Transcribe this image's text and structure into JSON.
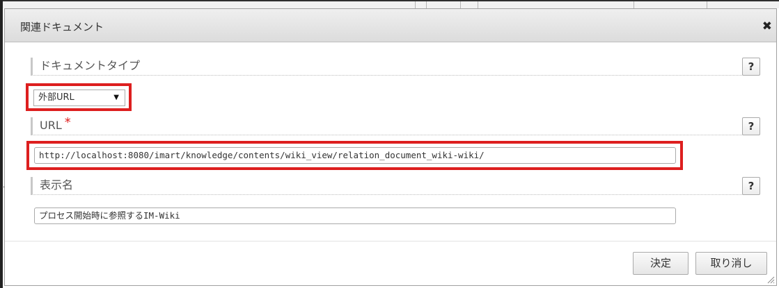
{
  "dialog": {
    "title": "関連ドキュメント",
    "close_icon": "close-icon"
  },
  "document_type": {
    "label": "ドキュメントタイプ",
    "selected": "外部URL",
    "help": "?"
  },
  "url": {
    "label": "URL",
    "required_mark": "*",
    "value": "http://localhost:8080/imart/knowledge/contents/wiki_view/relation_document_wiki-wiki/",
    "help": "?"
  },
  "display_name": {
    "label": "表示名",
    "value": "プロセス開始時に参照するIM-Wiki",
    "help": "?"
  },
  "buttons": {
    "ok": "決定",
    "cancel": "取り消し"
  },
  "colors": {
    "highlight": "#dd1f1f",
    "required": "#e02020"
  }
}
